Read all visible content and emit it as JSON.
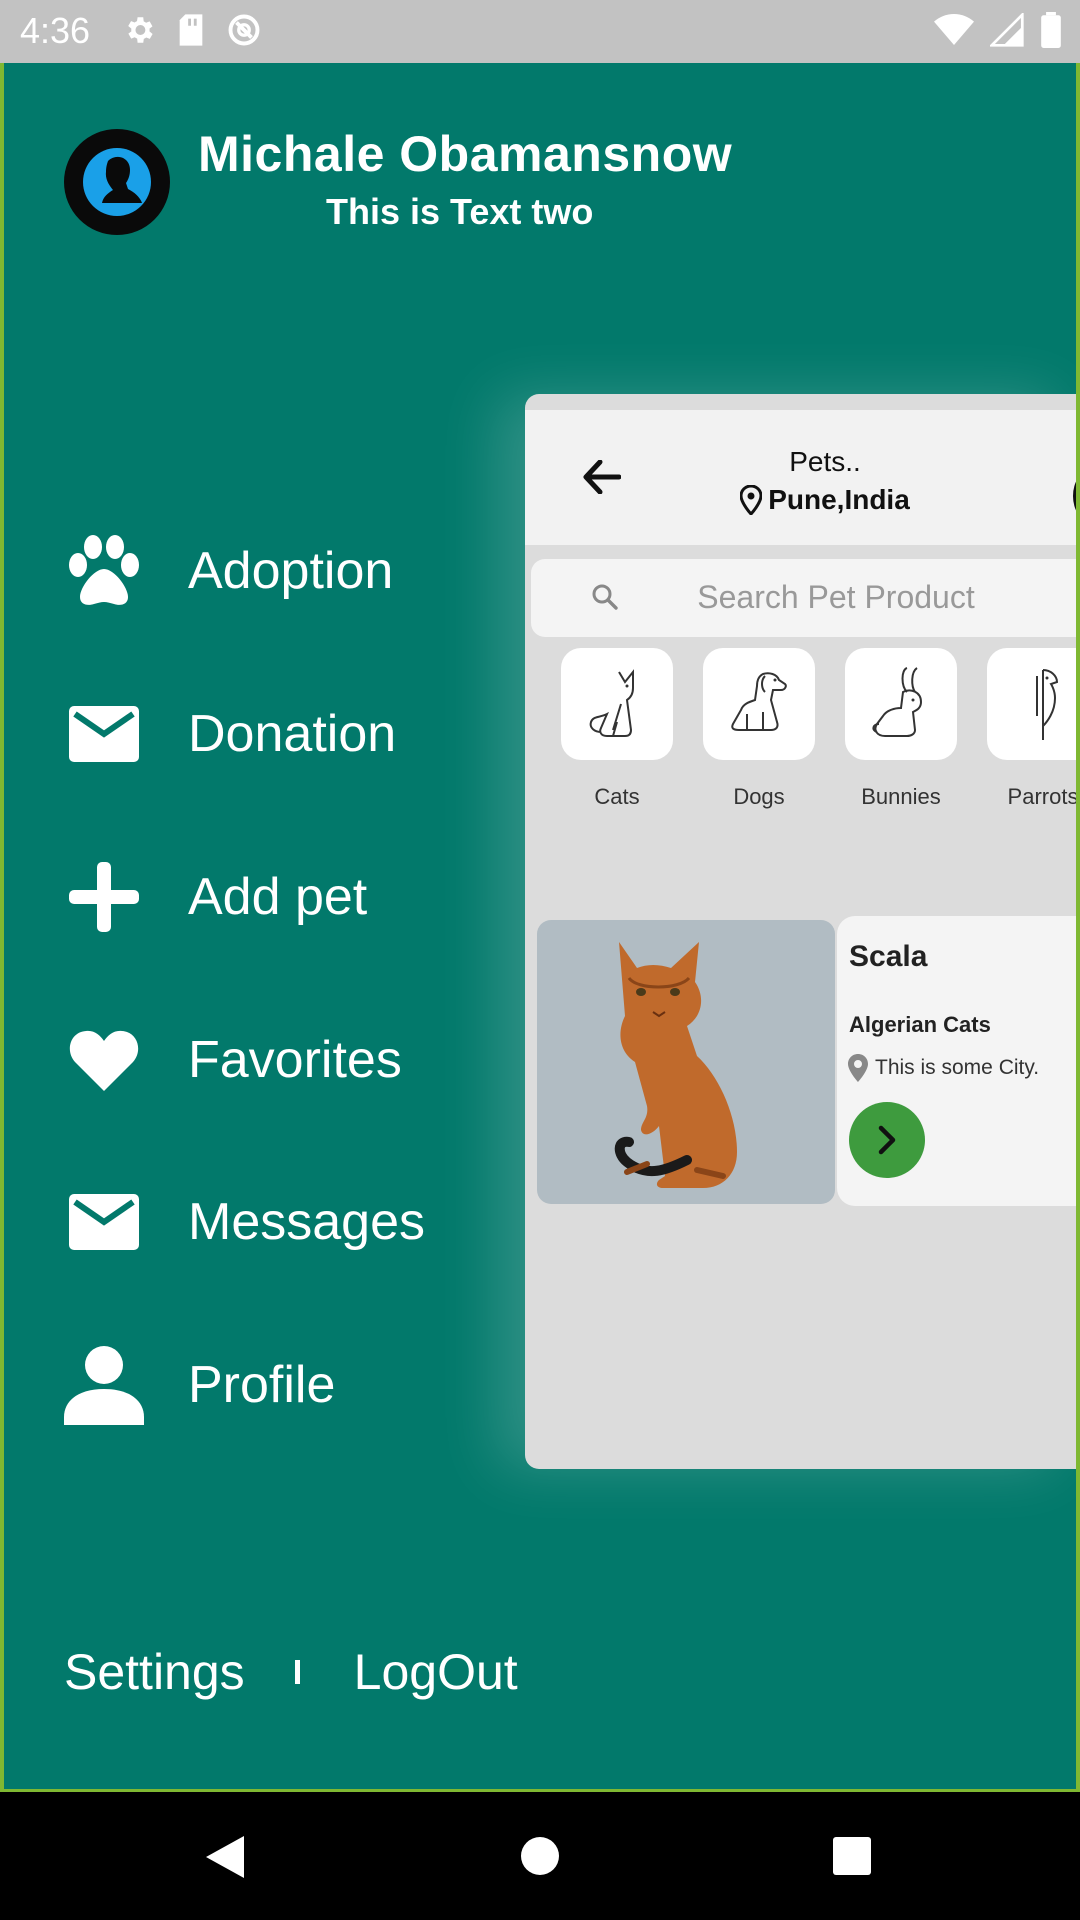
{
  "status_bar": {
    "time": "4:36",
    "left_icons": [
      "gear-icon",
      "sd-card-icon",
      "sync-icon"
    ],
    "right_icons": [
      "wifi-icon",
      "signal-icon",
      "battery-icon"
    ]
  },
  "drawer": {
    "background": "#02796b",
    "user": {
      "name": "Michale Obamansnow",
      "subtitle": "This is Text two",
      "avatar_icon": "user-silhouette-icon"
    },
    "menu": [
      {
        "label": "Adoption",
        "icon": "paw-icon"
      },
      {
        "label": "Donation",
        "icon": "mail-icon"
      },
      {
        "label": "Add pet",
        "icon": "plus-icon"
      },
      {
        "label": "Favorites",
        "icon": "heart-icon"
      },
      {
        "label": "Messages",
        "icon": "mail-icon"
      },
      {
        "label": "Profile",
        "icon": "person-icon"
      }
    ],
    "footer": {
      "settings": "Settings",
      "logout": "LogOut"
    }
  },
  "preview": {
    "header": {
      "title": "Pets..",
      "location": "Pune,India"
    },
    "search": {
      "placeholder": "Search Pet Product"
    },
    "categories": [
      {
        "label": "Cats",
        "icon": "cat-icon"
      },
      {
        "label": "Dogs",
        "icon": "dog-icon"
      },
      {
        "label": "Bunnies",
        "icon": "bunny-icon"
      },
      {
        "label": "Parrots",
        "icon": "parrot-icon"
      }
    ],
    "pet_card": {
      "name": "Scala",
      "breed": "Algerian Cats",
      "location": "This is some City.",
      "accent": "#3e9b3e"
    }
  },
  "nav_bar": {
    "buttons": [
      "back-icon",
      "home-icon",
      "recents-icon"
    ]
  }
}
